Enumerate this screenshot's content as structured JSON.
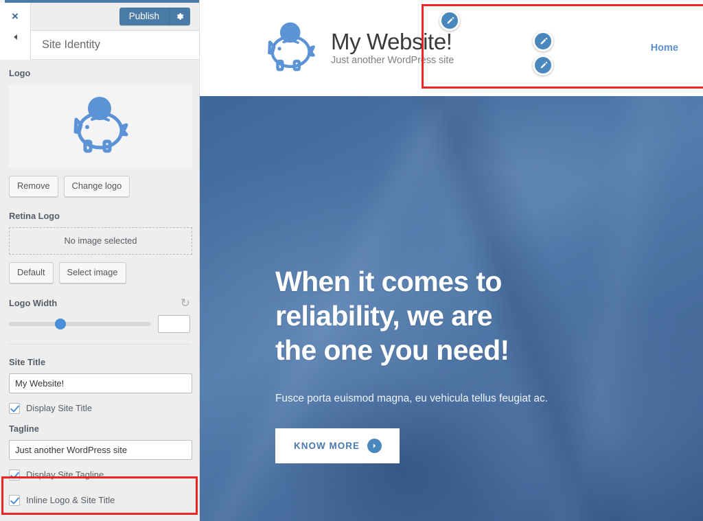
{
  "customizer": {
    "close_label": "×",
    "publish_label": "Publish",
    "gear_icon": "gear-icon",
    "panel_title": "Site Identity",
    "logo": {
      "section_label": "Logo",
      "remove_label": "Remove",
      "change_label": "Change logo",
      "logo_icon": "piggy-bank-icon"
    },
    "retina_logo": {
      "section_label": "Retina Logo",
      "empty_text": "No image selected",
      "default_label": "Default",
      "select_label": "Select image"
    },
    "logo_width": {
      "label": "Logo Width",
      "reset_icon": "reset-icon",
      "value": "",
      "slider_percent": 36
    },
    "site_title": {
      "label": "Site Title",
      "value": "My Website!"
    },
    "display_site_title": {
      "label": "Display Site Title",
      "checked": true
    },
    "tagline": {
      "label": "Tagline",
      "value": "Just another WordPress site"
    },
    "display_site_tagline": {
      "label": "Display Site Tagline",
      "checked": true
    },
    "inline_logo_site_title": {
      "label": "Inline Logo & Site Title",
      "checked": true
    },
    "highlight_color": "#ec2424",
    "accent_color": "#4a7ba7"
  },
  "preview": {
    "site_title": "My Website!",
    "site_tagline": "Just another WordPress site",
    "nav": {
      "home_label": "Home"
    },
    "edit_icons": {
      "header_icon": "pencil-edit-icon",
      "title_icon": "pencil-edit-icon",
      "tagline_icon": "pencil-edit-icon"
    },
    "hero": {
      "title": "When it comes to\nreliability, we are\nthe one you need!",
      "subtitle": "Fusce porta euismod magna, eu vehicula tellus feugiat ac.",
      "cta_label": "KNOW MORE",
      "cta_arrow_icon": "chevron-right-circle-icon",
      "overlay_color": "#4a81be"
    }
  }
}
